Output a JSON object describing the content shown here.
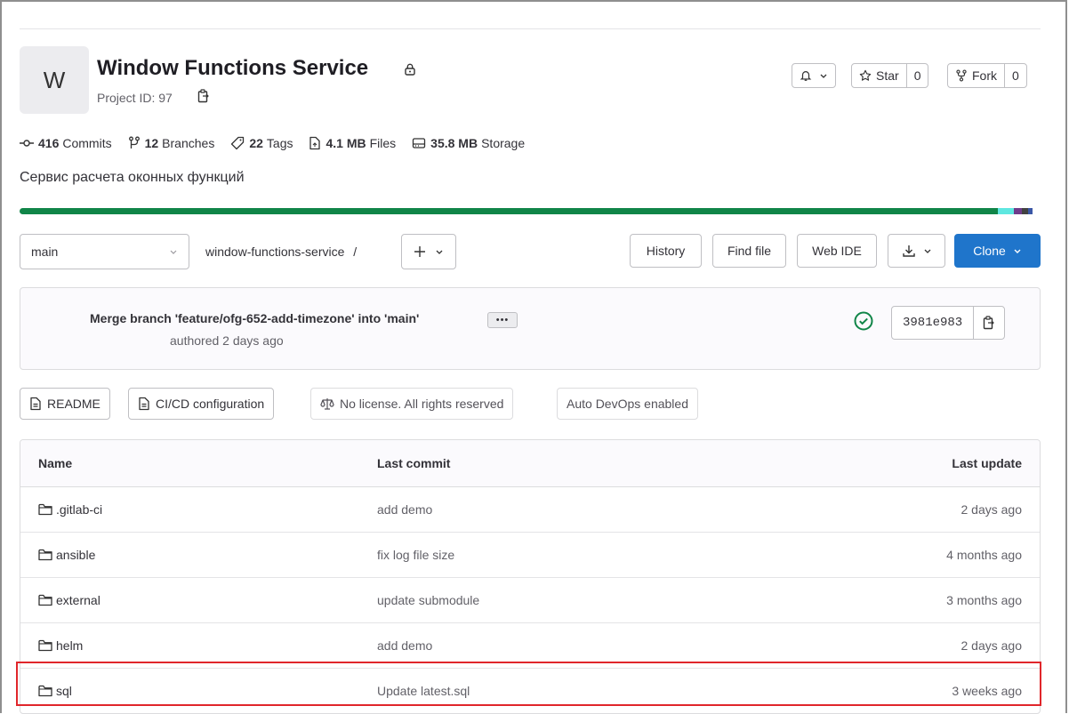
{
  "project": {
    "avatar_letter": "W",
    "title": "Window Functions Service",
    "project_id": "Project ID: 97",
    "description": "Сервис расчета оконных функций"
  },
  "actions": {
    "star_label": "Star",
    "star_count": "0",
    "fork_label": "Fork",
    "fork_count": "0"
  },
  "stats": [
    {
      "value": "416",
      "label": "Commits",
      "icon": "commit-icon"
    },
    {
      "value": "12",
      "label": "Branches",
      "icon": "branch-icon"
    },
    {
      "value": "22",
      "label": "Tags",
      "icon": "tag-icon"
    },
    {
      "value": "4.1 MB",
      "label": "Files",
      "icon": "file-icon"
    },
    {
      "value": "35.8 MB",
      "label": "Storage",
      "icon": "storage-icon"
    }
  ],
  "language_bar": [
    {
      "color": "#108548",
      "share": 0.958
    },
    {
      "color": "#5ee7e0",
      "share": 0.016
    },
    {
      "color": "#6f3b8a",
      "share": 0.008
    },
    {
      "color": "#424242",
      "share": 0.006
    },
    {
      "color": "#3a57a6",
      "share": 0.004
    }
  ],
  "repo_nav": {
    "branch": "main",
    "path": "window-functions-service",
    "path_separator": "/",
    "history": "History",
    "find_file": "Find file",
    "web_ide": "Web IDE",
    "clone": "Clone"
  },
  "commit": {
    "title": "Merge branch 'feature/ofg-652-add-timezone' into 'main'",
    "meta": "authored 2 days ago",
    "sha": "3981e983"
  },
  "badges": {
    "readme": "README",
    "cicd": "CI/CD configuration",
    "license": "No license. All rights reserved",
    "autodevops": "Auto DevOps enabled"
  },
  "table": {
    "headers": {
      "name": "Name",
      "last_commit": "Last commit",
      "last_update": "Last update"
    },
    "rows": [
      {
        "name": ".gitlab-ci",
        "commit": "add demo",
        "updated": "2 days ago"
      },
      {
        "name": "ansible",
        "commit": "fix log file size",
        "updated": "4 months ago"
      },
      {
        "name": "external",
        "commit": "update submodule",
        "updated": "3 months ago"
      },
      {
        "name": "helm",
        "commit": "add demo",
        "updated": "2 days ago"
      },
      {
        "name": "sql",
        "commit": "Update latest.sql",
        "updated": "3 weeks ago"
      }
    ]
  },
  "colors": {
    "primary": "#1f75cb",
    "success": "#108548",
    "highlight": "#e0262b"
  }
}
